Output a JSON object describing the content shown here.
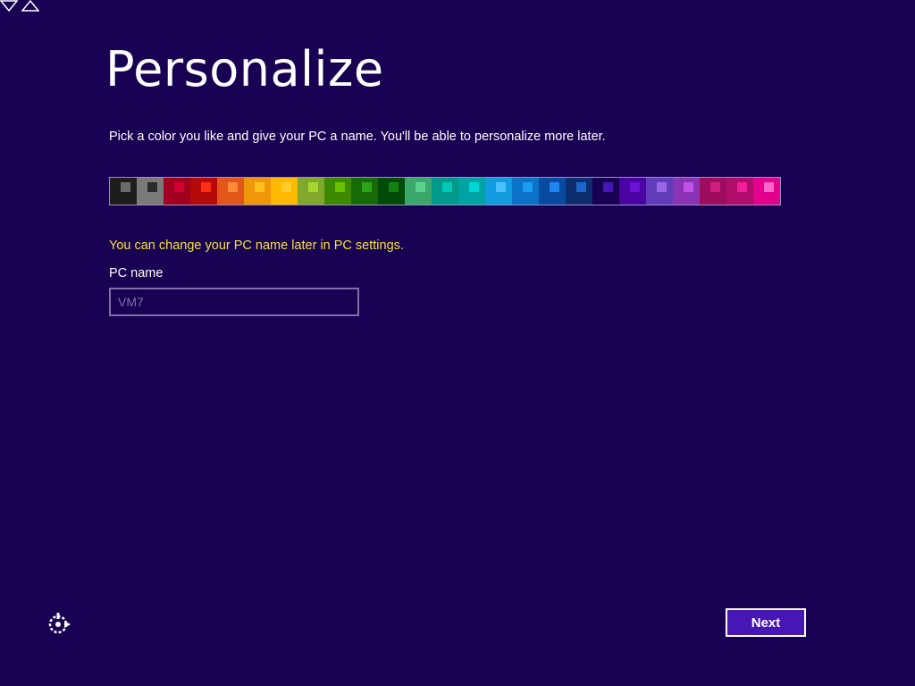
{
  "header": {
    "title": "Personalize"
  },
  "instructions": "Pick a color you like and give your PC a name. You'll be able to personalize more later.",
  "color_picker": {
    "selected_index": 18,
    "swatches": [
      {
        "bg": "#1d1d1d",
        "dot": "#6a6a6a"
      },
      {
        "bg": "#7a7a7a",
        "dot": "#2b2b2b"
      },
      {
        "bg": "#a2001f",
        "dot": "#d0002f"
      },
      {
        "bg": "#b50a0a",
        "dot": "#ff2e12"
      },
      {
        "bg": "#e2561a",
        "dot": "#ff8a3a"
      },
      {
        "bg": "#f09609",
        "dot": "#ffc21a"
      },
      {
        "bg": "#ffb900",
        "dot": "#ffcd2e"
      },
      {
        "bg": "#7fa82c",
        "dot": "#a4d72f"
      },
      {
        "bg": "#3d8a00",
        "dot": "#65c200"
      },
      {
        "bg": "#176b06",
        "dot": "#2ba41a"
      },
      {
        "bg": "#024a07",
        "dot": "#12820f"
      },
      {
        "bg": "#3aa86a",
        "dot": "#5bd18f"
      },
      {
        "bg": "#00998a",
        "dot": "#00c9b6"
      },
      {
        "bg": "#00a3a3",
        "dot": "#00d6d6"
      },
      {
        "bg": "#129cdf",
        "dot": "#4cc0ff"
      },
      {
        "bg": "#0a72c7",
        "dot": "#1a9cf0"
      },
      {
        "bg": "#074aa0",
        "dot": "#1f83f0"
      },
      {
        "bg": "#0d2e6e",
        "dot": "#1b66c9"
      },
      {
        "bg": "#180052",
        "dot": "#4617b4"
      },
      {
        "bg": "#4b02a3",
        "dot": "#6a12d6"
      },
      {
        "bg": "#603cba",
        "dot": "#9966e6"
      },
      {
        "bg": "#8a33b4",
        "dot": "#c052e6"
      },
      {
        "bg": "#9e0c5e",
        "dot": "#d01e7c"
      },
      {
        "bg": "#b00c6a",
        "dot": "#ef1f9a"
      },
      {
        "bg": "#e3008c",
        "dot": "#ff66cc"
      }
    ]
  },
  "hint": "You can change your PC name later in PC settings.",
  "pc_name": {
    "label": "PC name",
    "value": "",
    "placeholder": "VM7"
  },
  "footer": {
    "ease_of_access_icon": "ease-of-access-icon",
    "next_label": "Next"
  },
  "colors": {
    "background": "#180052",
    "hint": "#f3e33a",
    "next_button": "#4617b4"
  }
}
